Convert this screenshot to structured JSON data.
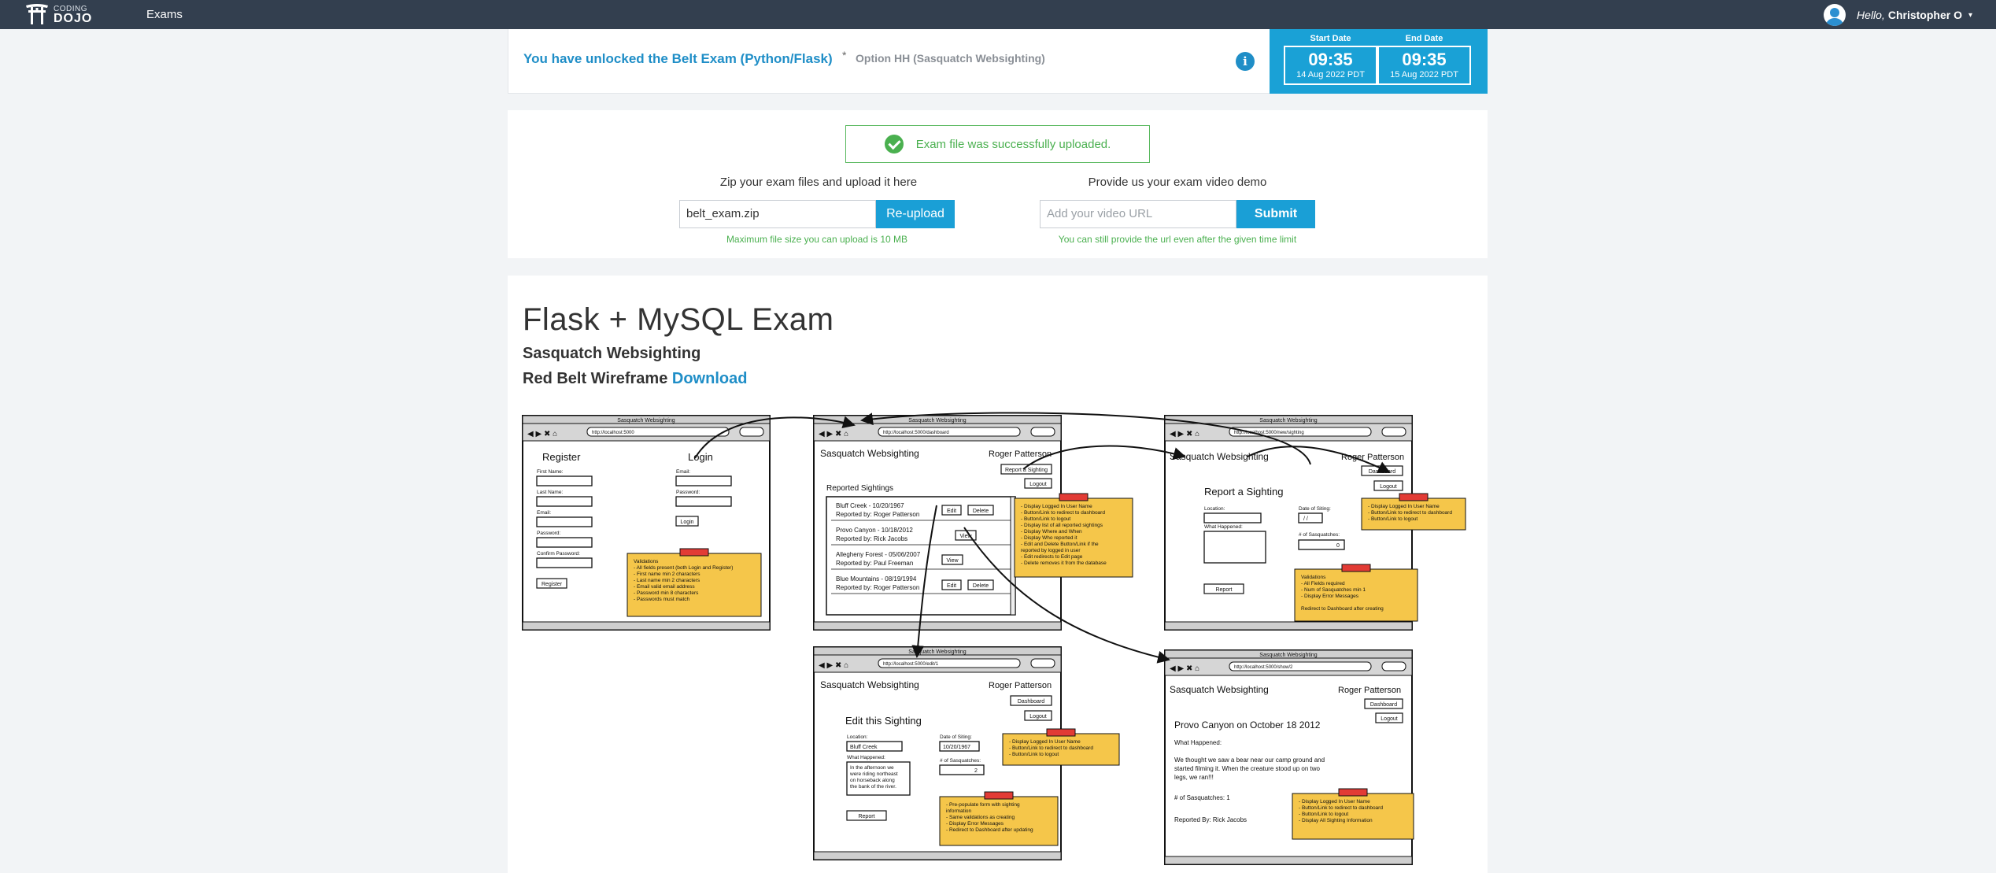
{
  "nav": {
    "logo_top": "CODING",
    "logo_bottom": "DOJO",
    "exams_link": "Exams",
    "greeting": "Hello,",
    "user_name": "Christopher O",
    "caret": "▾"
  },
  "exam_header": {
    "unlocked_text": "You have unlocked the Belt Exam (Python/Flask)",
    "separator": "*",
    "option_text": "Option HH (Sasquatch Websighting)",
    "info_icon": "i",
    "start_label": "Start Date",
    "start_time": "09:35",
    "start_day": "14 Aug 2022 PDT",
    "end_label": "End Date",
    "end_time": "09:35",
    "end_day": "15 Aug 2022 PDT"
  },
  "upload": {
    "success_message": "Exam file was successfully uploaded.",
    "zip_title": "Zip your exam files and upload it here",
    "zip_value": "belt_exam.zip",
    "reupload_label": "Re-upload",
    "zip_hint": "Maximum file size you can upload is 10 MB",
    "video_title": "Provide us your exam video demo",
    "video_placeholder": "Add your video URL",
    "submit_label": "Submit",
    "video_hint": "You can still provide the url even after the given time limit"
  },
  "exam": {
    "title": "Flask + MySQL Exam",
    "subtitle": "Sasquatch Websighting",
    "wireframe_label": "Red Belt Wireframe",
    "download_link": "Download"
  },
  "wireframe": {
    "window_title": "Sasquatch Websighting",
    "url_base": "http://localhost:5000",
    "url_dashboard": "http://localhost:5000/dashboard",
    "url_new": "http://localhost:5000/new/sighting",
    "url_edit": "http://localhost:5000/edit/1",
    "url_show": "http://localhost:5000/show/2",
    "app_name": "Sasquatch Websighting",
    "user": "Roger Patterson",
    "register": "Register",
    "login": "Login",
    "first_name": "First Name:",
    "last_name": "Last Name:",
    "email": "Email:",
    "password": "Password:",
    "confirm_password": "Confirm Password:",
    "register_btn": "Register",
    "login_btn": "Login",
    "validations_title": "Validations",
    "validations": [
      "- All fields present (both Login and Register)",
      "- First name min 2 characters",
      "- Last name min 2 characters",
      "- Email valid email address",
      "- Password min 8 characters",
      "- Passwords must match"
    ],
    "report_sighting_btn": "Report a Sighting",
    "logout_btn": "Logout",
    "dashboard_btn": "Dashboard",
    "reported_sightings": "Reported Sightings",
    "sightings": [
      {
        "title": "Bluff Creek - 10/20/1967",
        "by": "Reported by: Roger Patterson"
      },
      {
        "title": "Provo Canyon - 10/18/2012",
        "by": "Reported by: Rick Jacobs"
      },
      {
        "title": "Allegheny Forest - 05/06/2007",
        "by": "Reported by: Paul Freeman"
      },
      {
        "title": "Blue Mountains - 08/19/1994",
        "by": "Reported by: Roger Patterson"
      }
    ],
    "edit_btn": "Edit",
    "delete_btn": "Delete",
    "view_btn": "View",
    "dashboard_notes": [
      "- Display Logged In User Name",
      "- Button/Link to redirect to dashboard",
      "- Button/Link to logout",
      "- Display list of all reported sightings",
      "- Display Where and When",
      "- Display Who reported it",
      "- Edit and Delete Button/Link if the",
      "  reported by logged in user",
      "- Edit redirects to Edit page",
      "- Delete removes it from the database"
    ],
    "report_title": "Report a Sighting",
    "location": "Location:",
    "date_of_siting": "Date of Siting:",
    "what_happened": "What Happened:",
    "num_sasquatches": "# of Sasquatches:",
    "report_btn": "Report",
    "new_notes": [
      "- Display Logged In User Name",
      "- Button/Link to redirect to dashboard",
      "- Button/Link to logout"
    ],
    "new_validations": [
      "- All Fields required",
      "- Num of Sasquatches min 1",
      "- Display Error Messages",
      "",
      "Redirect to Dashboard after creating"
    ],
    "edit_title": "Edit this Sighting",
    "edit_location_val": "Bluff Creek",
    "edit_date_val": "10/20/1967",
    "edit_text": [
      "In the afternoon we",
      "were riding northeast",
      "on horseback along",
      "the bank of the river."
    ],
    "edit_num_val": "2",
    "edit_notes": [
      "- Display Logged In User Name",
      "- Button/Link to redirect to dashboard",
      "- Button/Link to logout"
    ],
    "edit_notes2": [
      "- Pre-populate form with sighting",
      "  information",
      "- Same validations as creating",
      "- Display Error Messages",
      "- Redirect to Dashboard after updating"
    ],
    "show_heading": "Provo Canyon on October 18 2012",
    "show_what": "What Happened:",
    "show_text": [
      "We thought we saw a bear near our camp ground and",
      "started filming it.  When the creature stood up on two",
      "legs, we ran!!!"
    ],
    "show_num": "# of Sasquatches: 1",
    "show_by": "Reported By: Rick Jacobs",
    "show_notes": [
      "- Display Logged In User Name",
      "- Button/Link to redirect to dashboard",
      "- Button/Link to logout",
      "- Display All Sighting Information"
    ],
    "date_placeholder": "/  /",
    "num_default": "0"
  }
}
